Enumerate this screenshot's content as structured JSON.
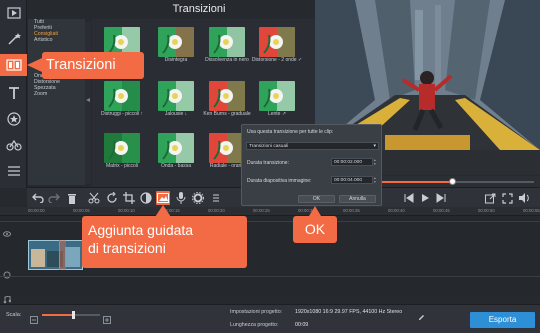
{
  "panel": {
    "title": "Transizioni"
  },
  "categories": [
    "Tutti",
    "Preferiti",
    "Consigliati",
    "Artistico",
    "",
    "",
    "",
    "",
    "",
    "Onda",
    "Distorsione",
    "Spezzata",
    "Zoom"
  ],
  "selected_category_index": 2,
  "tiles": [
    {
      "label": "",
      "colors": [
        "#2fa35a",
        "#e9e9e9"
      ]
    },
    {
      "label": "Disintegra",
      "colors": [
        "#2fa35a",
        "#c94a3e"
      ]
    },
    {
      "label": "Dissolvenza in nero",
      "colors": [
        "#2fa35a",
        "#e0e0e0"
      ]
    },
    {
      "label": "Distorsione - 2 onde ✓",
      "colors": [
        "#e0473a",
        "#2fa35a"
      ]
    },
    {
      "label": "",
      "colors": [
        "#2fa35a",
        "#e9e9e9"
      ]
    },
    {
      "label": "Distruggi - piccoli ↑",
      "colors": [
        "#2fa35a",
        "#1e7a3e"
      ]
    },
    {
      "label": "Jalousie ↓",
      "colors": [
        "#2fa35a",
        "#e9e9e9"
      ]
    },
    {
      "label": "Ken Burns - graduale",
      "colors": [
        "#e0473a",
        "#2fa35a"
      ]
    },
    {
      "label": "Lente ↗",
      "colors": [
        "#2fa35a",
        "#e9e9e9"
      ]
    },
    {
      "label": "",
      "colors": [
        "#2fa35a",
        "#e9e9e9"
      ]
    },
    {
      "label": "Matrix - piccoli",
      "colors": [
        "#1f7a3b",
        "#2fa35a"
      ]
    },
    {
      "label": "Onda - bassa",
      "colors": [
        "#2fa35a",
        "#e9e9e9"
      ]
    },
    {
      "label": "Radiale - orario",
      "colors": [
        "#e0473a",
        "#2fa35a"
      ]
    },
    {
      "label": "",
      "colors": [
        "#2fa35a",
        "#e9e9e9"
      ]
    }
  ],
  "callouts": {
    "transizioni": "Transizioni",
    "wizard": "Aggiunta guidata\ndi transizioni",
    "ok": "OK"
  },
  "dialog": {
    "heading": "Usa questa transizione per tutte le clip:",
    "select_value": "Transizioni casuali",
    "duration_label": "Durata transizione:",
    "duration_value": "00:00:02.000",
    "slide_label": "Durata diapositiva immagine:",
    "slide_value": "00:00:04.000",
    "ok": "OK",
    "cancel": "Annulla"
  },
  "ruler": [
    "00:00:00",
    "00:00:05",
    "00:00:10",
    "00:00:15",
    "00:00:20",
    "00:00:25",
    "00:00:30",
    "00:00:35",
    "00:00:40",
    "00:00:45",
    "00:00:50",
    "00:00:55"
  ],
  "bottom": {
    "scale_label": "Scala:",
    "settings_label": "Impostazioni progetto:",
    "settings_value": "1920x1080 16:9 29.97 FPS, 44100 Hz Stereo",
    "length_label": "Lunghezza progetto:",
    "length_value": "00:09",
    "export": "Esporta"
  },
  "progress": {
    "played_fraction": 0.62
  },
  "colors": {
    "accent": "#f26b44",
    "panel": "#30343b",
    "dark": "#1a1c20"
  }
}
